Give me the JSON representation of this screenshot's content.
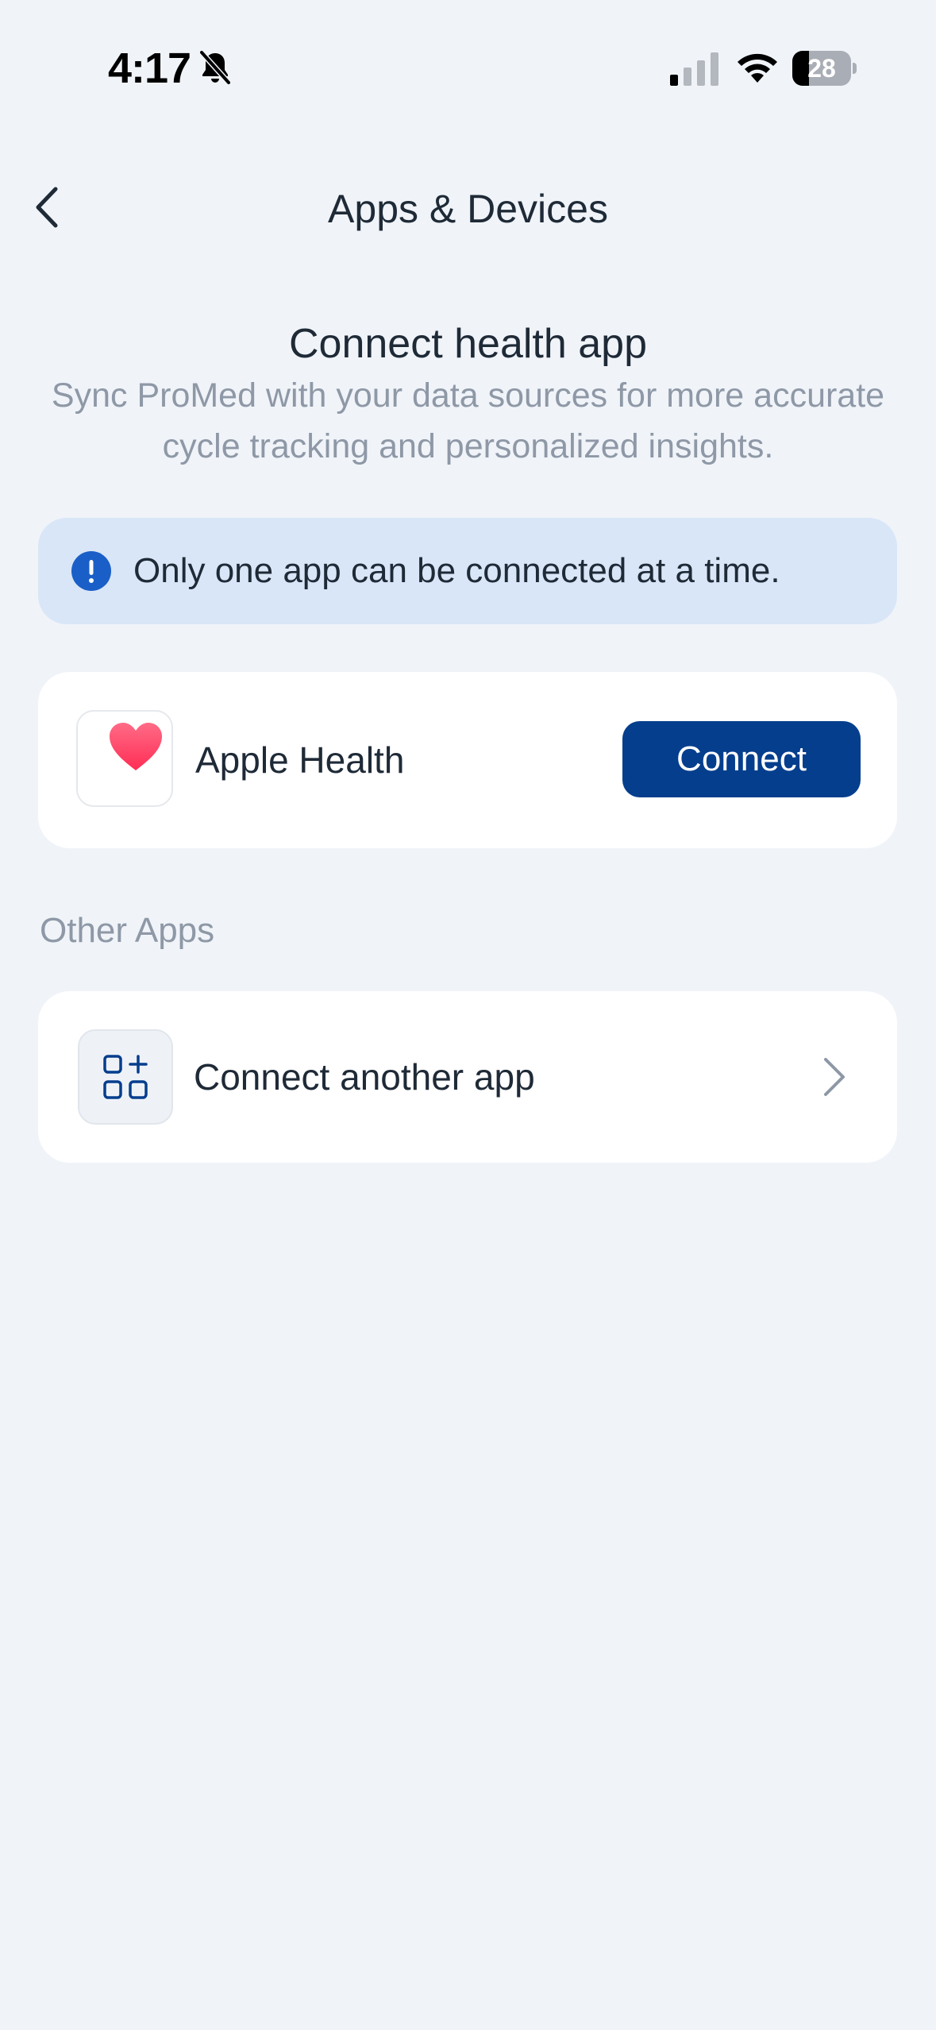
{
  "status_bar": {
    "time": "4:17",
    "battery_level": "28",
    "battery_percent": 28,
    "icons": [
      "bell-slash-icon",
      "cellular-signal-icon",
      "wifi-icon",
      "battery-icon"
    ]
  },
  "nav": {
    "title": "Apps & Devices",
    "back_icon": "chevron-left-icon"
  },
  "header": {
    "title": "Connect health app",
    "subtitle": "Sync ProMed with your data sources for more accurate cycle tracking and personalized insights."
  },
  "info_banner": {
    "icon": "exclamation-circle-icon",
    "text": "Only one app can be connected at a time."
  },
  "health_app": {
    "icon": "heart-icon",
    "name": "Apple Health",
    "connect_label": "Connect"
  },
  "other_apps": {
    "section_label": "Other Apps",
    "item_icon": "apps-add-icon",
    "item_label": "Connect another app",
    "item_chevron": "chevron-right-icon"
  },
  "colors": {
    "background": "#f0f4f9",
    "card": "#ffffff",
    "banner": "#d9e6f7",
    "primary": "#053e8d",
    "info_icon": "#1a5fc7",
    "heart": "#ff3b5c",
    "muted_text": "#8e98a6",
    "text": "#1f2a37"
  }
}
